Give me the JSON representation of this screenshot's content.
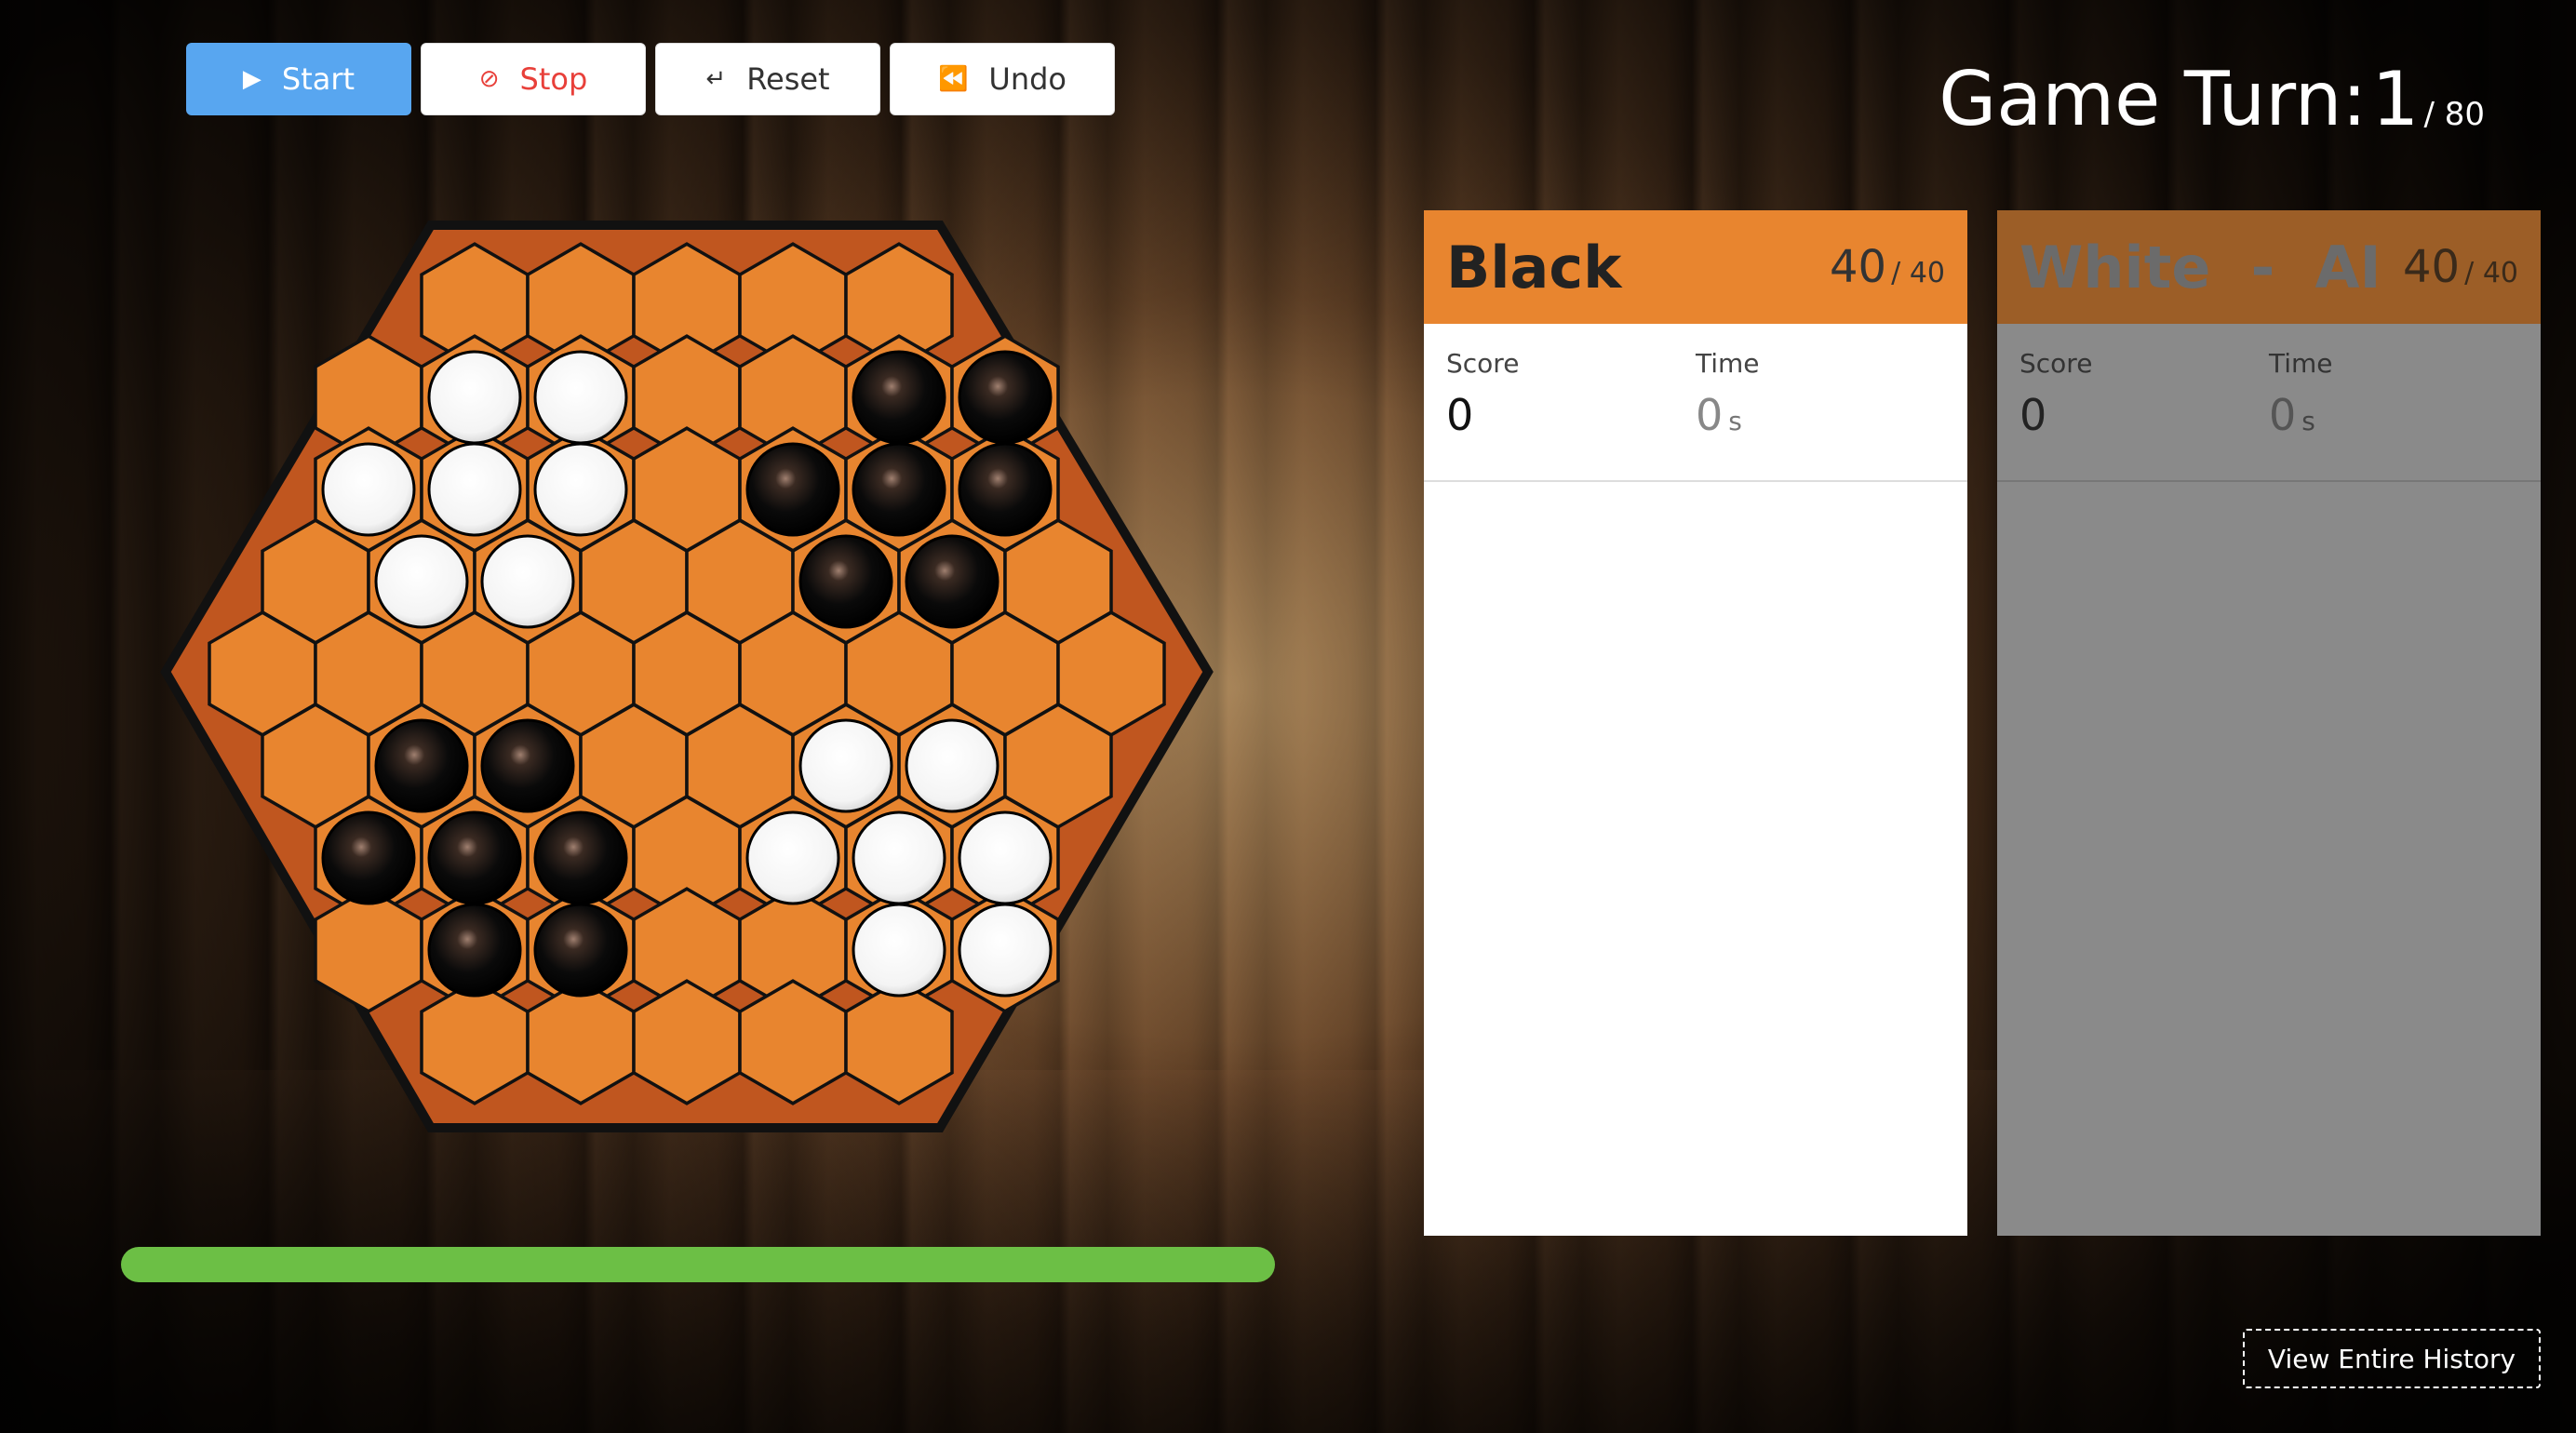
{
  "toolbar": {
    "start_label": "Start",
    "stop_label": "Stop",
    "reset_label": "Reset",
    "undo_label": "Undo"
  },
  "turn": {
    "label": "Game Turn:",
    "current": "1",
    "total": "/ 80"
  },
  "board": {
    "colors": {
      "frame": "#c0561f",
      "cell": "#e8852f",
      "outline": "#111111"
    },
    "rows": [
      [
        "",
        "",
        "",
        "",
        ""
      ],
      [
        "",
        "W",
        "W",
        "",
        "",
        "B",
        "B"
      ],
      [
        "W",
        "W",
        "W",
        "",
        "B",
        "B",
        "B"
      ],
      [
        "",
        "W",
        "W",
        "",
        "",
        "B",
        "B",
        ""
      ],
      [
        "",
        "",
        "",
        "",
        "",
        "",
        "",
        "",
        ""
      ],
      [
        "",
        "B",
        "B",
        "",
        "",
        "W",
        "W",
        ""
      ],
      [
        "B",
        "B",
        "B",
        "",
        "W",
        "W",
        "W"
      ],
      [
        "",
        "B",
        "B",
        "",
        "",
        "W",
        "W"
      ],
      [
        "",
        "",
        "",
        "",
        ""
      ]
    ]
  },
  "progress": {
    "fraction": 1.0,
    "color": "#6cbf45"
  },
  "players": [
    {
      "name": "Black",
      "count": "40",
      "count_total": "/ 40",
      "score_label": "Score",
      "score": "0",
      "time_label": "Time",
      "time": "0",
      "time_unit": "s",
      "accent": "#e8852f",
      "active": true
    },
    {
      "name": "White  -  AI",
      "count": "40",
      "count_total": "/ 40",
      "score_label": "Score",
      "score": "0",
      "time_label": "Time",
      "time": "0",
      "time_unit": "s",
      "accent": "#9c5e27",
      "active": false
    }
  ],
  "history": {
    "label": "View Entire History"
  }
}
